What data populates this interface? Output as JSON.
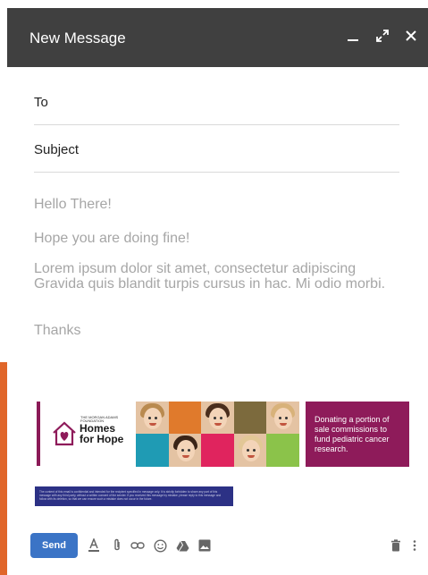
{
  "window": {
    "title": "New Message",
    "minimize_icon": "minimize-icon",
    "expand_icon": "expand-icon",
    "close_icon": "close-icon"
  },
  "fields": {
    "to_label": "To",
    "subject_label": "Subject"
  },
  "body": {
    "greeting": "Hello There!",
    "line1": "Hope you are doing fine!",
    "paragraph": "Lorem ipsum dolor sit amet, consectetur adipiscing Gravida quis blandit turpis cursus in hac. Mi odio morbi.",
    "closing": "Thanks"
  },
  "signature": {
    "logo_small": "THE MORGAN ADAMS FOUNDATION",
    "logo_text_line1": "Homes",
    "logo_text_line2": "for Hope",
    "promo_text": "Donating a portion of sale commissions to fund pediatric cancer research.",
    "accent_color": "#8e1b5a",
    "disclaimer": "The content of this email is confidential and intended for the recipient specified in message only. It is strictly forbidden to share any part of this message with any third party, without a written consent of the sender. If you received this message by mistake, please reply to this message and follow with its deletion, so that we can ensure such a mistake does not occur in the future."
  },
  "toolbar": {
    "send_label": "Send",
    "send_color": "#3b74c6",
    "icons": [
      "format-text-icon",
      "attach-icon",
      "link-icon",
      "emoji-icon",
      "drive-icon",
      "image-icon",
      "delete-icon",
      "more-options-icon"
    ]
  },
  "colors": {
    "titlebar": "#404040",
    "left_strip": "#e0662a",
    "body_text": "#a6a6a6"
  }
}
